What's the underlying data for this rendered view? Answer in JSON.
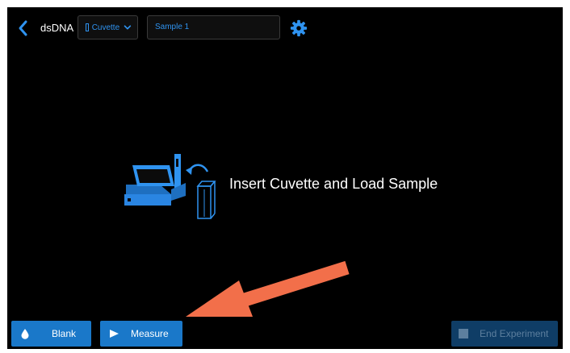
{
  "header": {
    "app_title": "dsDNA",
    "mode_dropdown": {
      "selected": "Cuvette"
    },
    "sample_name": "Sample 1"
  },
  "main": {
    "instruction": "Insert Cuvette and Load Sample"
  },
  "footer": {
    "blank_label": "Blank",
    "measure_label": "Measure",
    "end_label": "End Experiment"
  },
  "colors": {
    "accent": "#2f93f0",
    "button": "#1a78c9",
    "button_disabled": "#0f3d66",
    "annotation_arrow": "#f26f4a"
  }
}
